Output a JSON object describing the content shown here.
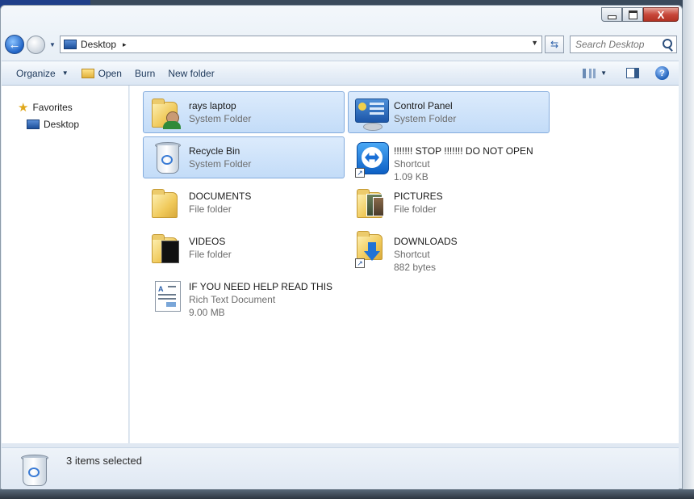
{
  "window": {
    "caption": {
      "close_glyph": "X"
    }
  },
  "address_bar": {
    "location": "Desktop",
    "separator": "▸"
  },
  "search": {
    "placeholder": "Search Desktop"
  },
  "toolbar": {
    "organize": "Organize",
    "open": "Open",
    "burn": "Burn",
    "new_folder": "New folder"
  },
  "nav_pane": {
    "favorites": "Favorites",
    "desktop": "Desktop"
  },
  "items": [
    {
      "name": "rays laptop",
      "type": "System Folder",
      "selected": true,
      "icon": "user-folder-icon"
    },
    {
      "name": "Control Panel",
      "type": "System Folder",
      "selected": true,
      "icon": "control-panel-icon"
    },
    {
      "name": "Recycle Bin",
      "type": "System Folder",
      "selected": true,
      "icon": "recycle-bin-icon"
    },
    {
      "name": "!!!!!!! STOP !!!!!!! DO NOT OPEN",
      "type": "Shortcut",
      "size": "1.09 KB",
      "selected": false,
      "icon": "teamviewer-shortcut-icon"
    },
    {
      "name": "DOCUMENTS",
      "type": "File folder",
      "selected": false,
      "icon": "folder-icon"
    },
    {
      "name": "PICTURES",
      "type": "File folder",
      "selected": false,
      "icon": "pictures-folder-icon"
    },
    {
      "name": "VIDEOS",
      "type": "File folder",
      "selected": false,
      "icon": "videos-folder-icon"
    },
    {
      "name": "DOWNLOADS",
      "type": "Shortcut",
      "size": "882 bytes",
      "selected": false,
      "icon": "downloads-shortcut-icon"
    },
    {
      "name": "IF YOU NEED HELP READ THIS",
      "type": "Rich Text Document",
      "size": "9.00 MB",
      "selected": false,
      "icon": "rtf-document-icon"
    }
  ],
  "status_bar": {
    "text": "3 items selected"
  },
  "colors": {
    "selection_fill": "#c3dcf8",
    "selection_border": "#84acdd",
    "toolbar_text": "#1e395b"
  }
}
